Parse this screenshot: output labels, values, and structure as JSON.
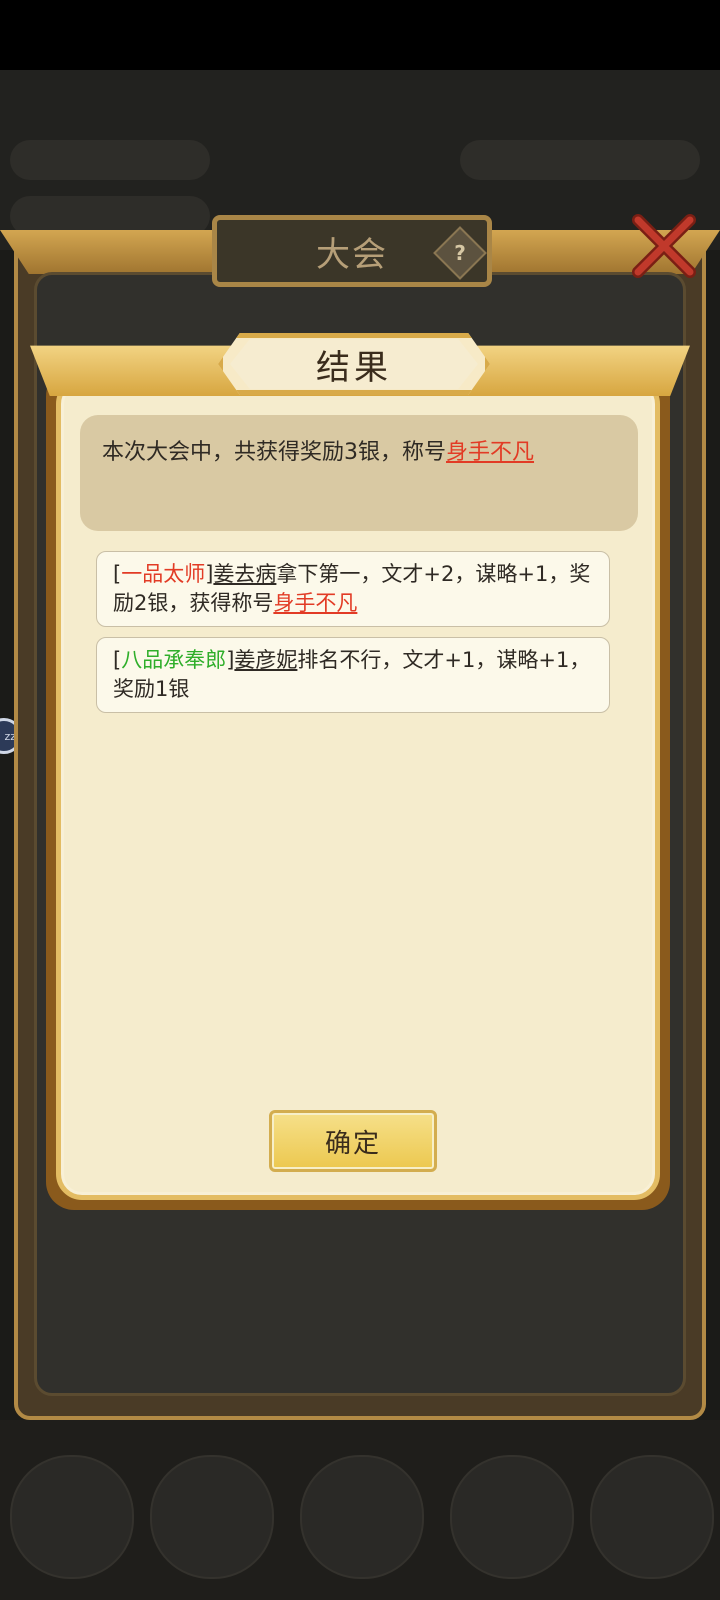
{
  "outer_dialog": {
    "title": "大会",
    "help_icon_glyph": "?"
  },
  "result_dialog": {
    "title": "结果",
    "summary": {
      "text": "本次大会中，共获得奖励3银，称号",
      "honor_title": "身手不凡"
    },
    "entries": [
      {
        "rank": "一品太师",
        "rank_color": "#e23b25",
        "name": "姜去病",
        "text": "拿下第一，文才+2，谋略+1，奖励2银，获得称号",
        "honor_title": "身手不凡"
      },
      {
        "rank": "八品承奉郎",
        "rank_color": "#2fae2a",
        "name": "姜彦妮",
        "text": "排名不行，文才+1，谋略+1，奖励1银",
        "honor_title": ""
      }
    ],
    "confirm_label": "确定"
  },
  "side_bubble": {
    "text": "zz"
  },
  "colors": {
    "accent_gold": "#e3bc63",
    "panel_cream": "#f5eccd",
    "highlight_red": "#e23b25",
    "highlight_green": "#2fae2a"
  }
}
